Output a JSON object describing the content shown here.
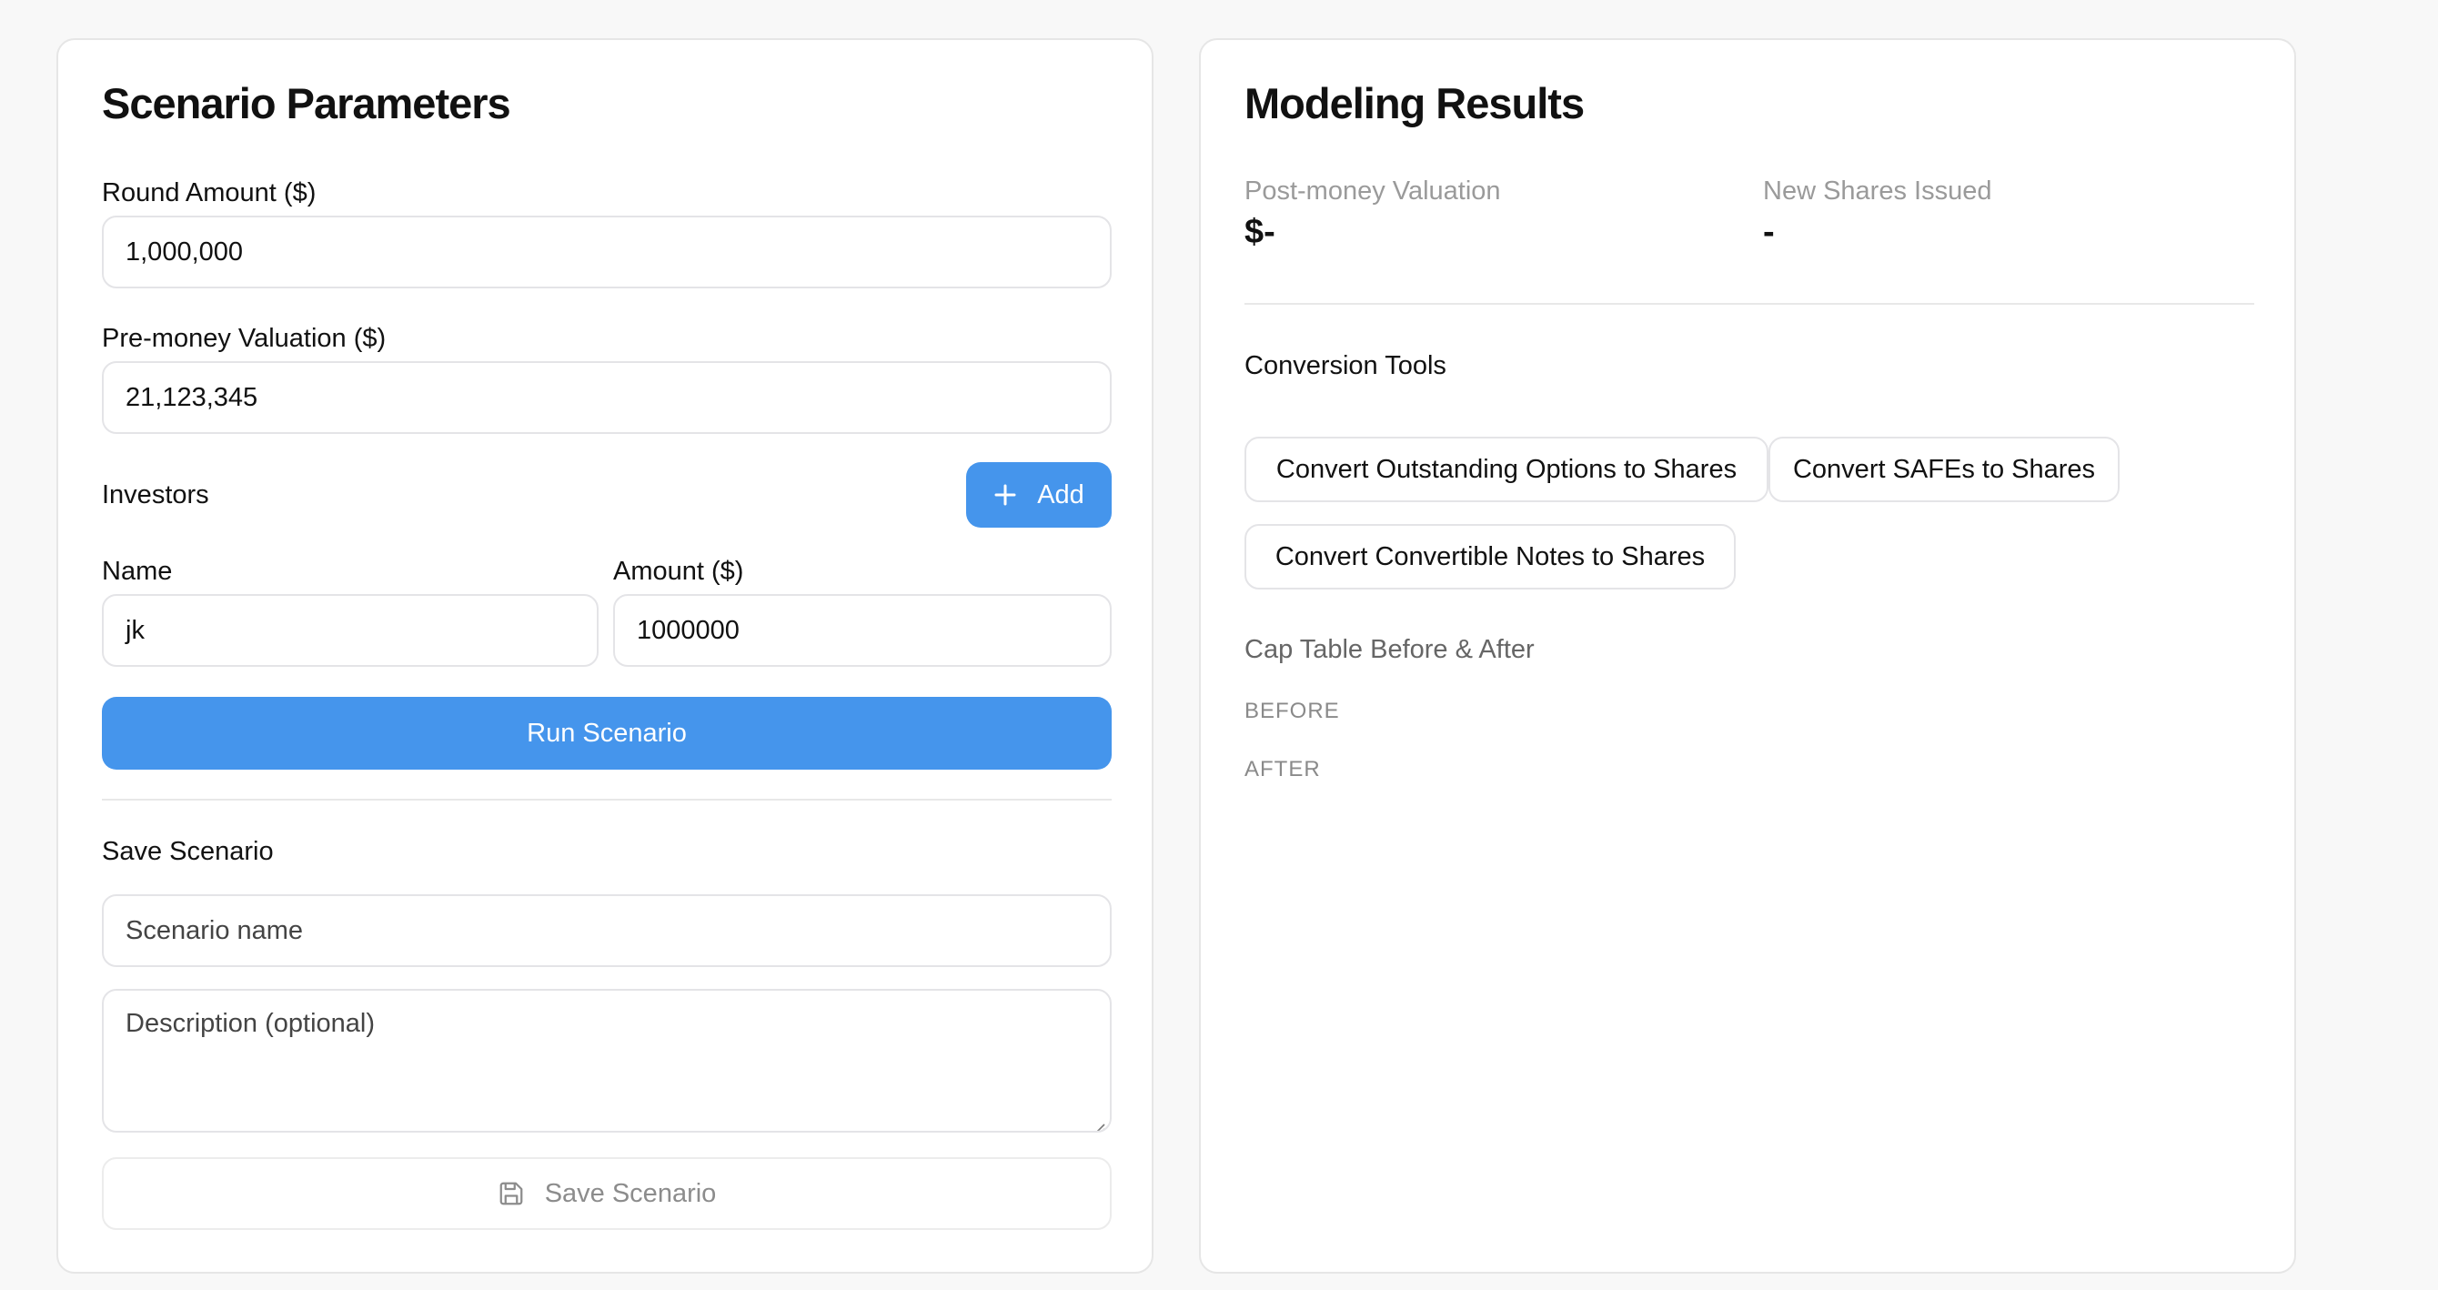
{
  "parameters": {
    "title": "Scenario Parameters",
    "round_amount_label": "Round Amount ($)",
    "round_amount_value": "1,000,000",
    "pre_money_label": "Pre-money Valuation ($)",
    "pre_money_value": "21,123,345",
    "investors_label": "Investors",
    "add_button_label": "Add",
    "name_col_label": "Name",
    "amount_col_label": "Amount ($)",
    "investor_name": "jk",
    "investor_amount": "1000000",
    "run_button_label": "Run Scenario",
    "save_section_label": "Save Scenario",
    "scenario_name_placeholder": "Scenario name",
    "description_placeholder": "Description (optional)",
    "save_button_label": "Save Scenario"
  },
  "results": {
    "title": "Modeling Results",
    "post_money_label": "Post-money Valuation",
    "post_money_value": "$-",
    "new_shares_label": "New Shares Issued",
    "new_shares_value": "-",
    "conversion_tools_label": "Conversion Tools",
    "convert_options_label": "Convert Outstanding Options to Shares",
    "convert_safes_label": "Convert SAFEs to Shares",
    "convert_notes_label": "Convert Convertible Notes to Shares",
    "cap_table_label": "Cap Table Before & After",
    "before_label": "BEFORE",
    "after_label": "AFTER"
  },
  "icons": {
    "add": "plus-icon",
    "save": "save-icon"
  },
  "colors": {
    "primary": "#4595ec",
    "background": "#f8f8f8",
    "card": "#ffffff"
  }
}
